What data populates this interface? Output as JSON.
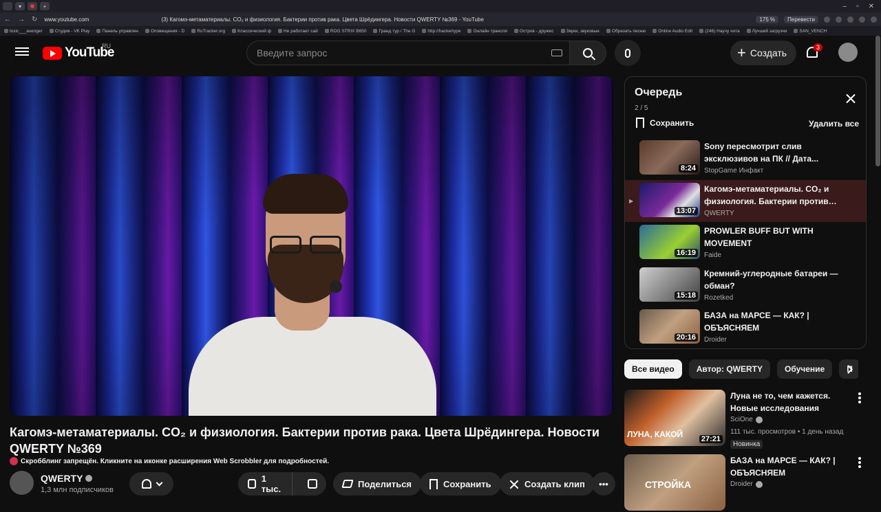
{
  "browser": {
    "url": "www.youtube.com",
    "tab_title": "(3) Кагомэ-метаматериалы. CO₂ и физиология. Бактерии против рака. Цвета Шрёдингера. Новости QWERTY №369 - YouTube",
    "zoom": "175 %",
    "translate": "Перевести",
    "bookmarks": [
      "toxic___avenger",
      "Студия - VK Play",
      "Панель управлен",
      "Оповещения - D",
      "RuTracker.org",
      "Классический ф",
      "Не работает сай",
      "ROG STRIX B650",
      "Гранд тур / The G",
      "http://hackertype",
      "Онлайн трансля",
      "Остров - дружес",
      "Звуки, звуковые",
      "Обрезать песню",
      "Online Audio Edit",
      "(246) Научу чита",
      "Лучший загрузчи",
      "SAN_VENCH"
    ]
  },
  "masthead": {
    "logo_text": "YouTube",
    "region": "RU",
    "search_placeholder": "Введите запрос",
    "create_label": "Создать",
    "notifications_count": "3"
  },
  "video": {
    "title": "Кагомэ-метаматериалы. CO₂ и физиология. Бактерии против рака. Цвета Шрёдингера. Новости QWERTY №369",
    "scrobble_notice": "Скробблинг запрещён. Кликните на иконке расширения Web Scrobbler для подробностей.",
    "channel": "QWERTY",
    "subscribers": "1,3 млн подписчиков",
    "likes": "1 тыс.",
    "share_label": "Поделиться",
    "save_label": "Сохранить",
    "clip_label": "Создать клип"
  },
  "queue": {
    "title": "Очередь",
    "position": "2 / 5",
    "save_label": "Сохранить",
    "delete_label": "Удалить все",
    "items": [
      {
        "title": "Sony пересмотрит слив эксклюзивов на ПК // Дата...",
        "channel": "StopGame Инфакт",
        "duration": "8:24",
        "active": false,
        "thumb": "linear-gradient(135deg,#5a3a2a,#8a6a5a 50%,#2a1a1a)"
      },
      {
        "title": "Кагомэ-метаматериалы. CO₂ и физиология. Бактерии против рака....",
        "channel": "QWERTY",
        "duration": "13:07",
        "active": true,
        "thumb": "linear-gradient(135deg,#1a1a6a,#7a2a9a 50%,#e0e0e0 70%,#1a3a8a)"
      },
      {
        "title": "PROWLER BUFF BUT WITH MOVEMENT",
        "channel": "Faide",
        "duration": "16:19",
        "active": false,
        "thumb": "linear-gradient(135deg,#2a6a9a,#9ad030 60%,#2a4a6a)"
      },
      {
        "title": "Кремний-углеродные батареи — обман?",
        "channel": "Rozetked",
        "duration": "15:18",
        "active": false,
        "thumb": "linear-gradient(135deg,#cfcfcf,#8a8a8a 50%,#404040)"
      },
      {
        "title": "БАЗА на МАРСЕ — КАК? | ОБЪЯСНЯЕМ",
        "channel": "Droider",
        "duration": "20:16",
        "active": false,
        "thumb": "linear-gradient(135deg,#6a5a4a,#c0a080 50%,#8a6040)"
      }
    ]
  },
  "chips": [
    "Все видео",
    "Автор: QWERTY",
    "Обучение",
    "П"
  ],
  "recommendations": [
    {
      "title": "Луна не то, чем кажется. Новые исследования",
      "channel": "SciOne",
      "meta": "111 тыс. просмотров • 1 день назад",
      "badge": "Новинка",
      "duration": "27:21",
      "thumb": "linear-gradient(135deg,#1a1a1a,#c0602a 35%,#e0c0a0 60%,#2a2a2a)",
      "thumb_caption": "ЛУНА, КАКОЙ"
    },
    {
      "title": "БАЗА на МАРСЕ — КАК? | ОБЪЯСНЯЕМ",
      "channel": "Droider",
      "meta": "",
      "badge": "",
      "duration": "",
      "thumb": "linear-gradient(135deg,#6a5a4a,#c0a080 50%,#8a6040)",
      "thumb_caption": "СТРОЙКА"
    }
  ],
  "colors": {
    "accent": "#ff0000",
    "background": "#0f0f0f",
    "active_queue_item": "#3a1a1a"
  }
}
